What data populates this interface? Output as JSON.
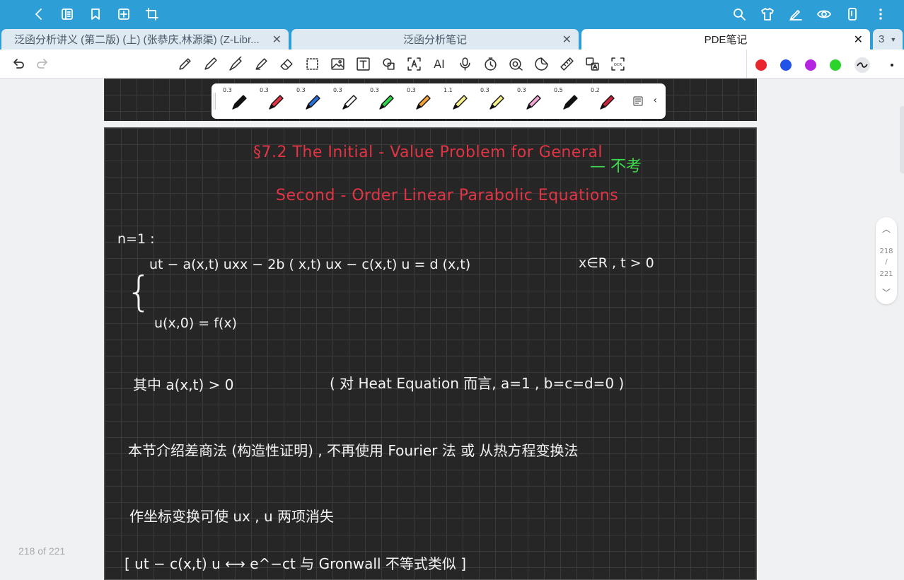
{
  "tabs": [
    {
      "label": "泛函分析讲义 (第二版) (上) (张恭庆,林源渠) (Z-Libr..."
    },
    {
      "label": "泛函分析笔记"
    },
    {
      "label": "PDE笔记"
    }
  ],
  "tab_count": "3",
  "colors": {
    "palette": [
      "#e8262c",
      "#2153e8",
      "#b325e0",
      "#2bd42b"
    ],
    "accent": "#2d9ed6"
  },
  "pens": [
    {
      "size": "0.3",
      "color": "#111111"
    },
    {
      "size": "0.3",
      "color": "#e23444"
    },
    {
      "size": "0.3",
      "color": "#2a6fd8"
    },
    {
      "size": "0.3",
      "color": "#ffffff"
    },
    {
      "size": "0.3",
      "color": "#2fd24a"
    },
    {
      "size": "0.3",
      "color": "#f3a33a"
    },
    {
      "size": "1.1",
      "color": "#f6f08a"
    },
    {
      "size": "0.3",
      "color": "#f6f08a"
    },
    {
      "size": "0.3",
      "color": "#f2a6d6"
    },
    {
      "size": "0.5",
      "color": "#111111"
    },
    {
      "size": "0.2",
      "color": "#c8243a"
    }
  ],
  "note": {
    "title_line1": "§7.2   The  Initial - Value  Problem  for  General",
    "title_line2": "Second - Order   Linear   Parabolic   Equations",
    "tag": "— 不考",
    "n_label": "n=1 :",
    "eq1": "ut − a(x,t) uxx  − 2b ( x,t) ux  −  c(x,t) u = d (x,t)",
    "domain": "x∈R ,   t > 0",
    "brace": "{",
    "eq2": "u(x,0)  =  f(x)",
    "cond": "其中  a(x,t) > 0",
    "remark": "( 对 Heat Equation 而言,  a=1 ,  b=c=d=0 )",
    "line3": "本节介绍差商法 (构造性证明) ,  不再使用  Fourier 法  或   从热方程变换法",
    "line4": "作坐标变换可使   ux , u   两项消失",
    "line5": "[  ut − c(x,t) u  ⟷  e^−ct      与 Gronwall 不等式类似  ]"
  },
  "pager": {
    "current": "218",
    "sep": "/",
    "total": "221"
  },
  "page_indicator": "218 of 221"
}
